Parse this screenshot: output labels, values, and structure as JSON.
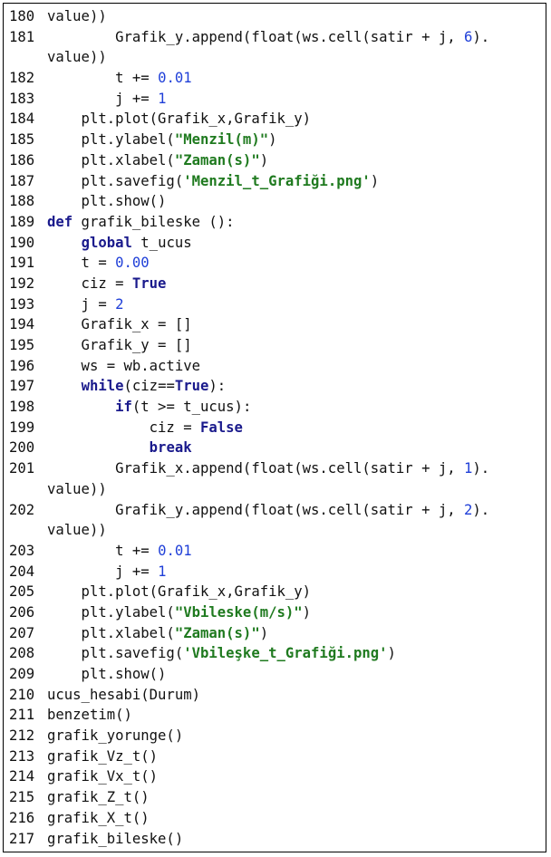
{
  "lines": [
    {
      "n": "180",
      "parts": [
        [
          "t",
          "value))"
        ]
      ]
    },
    {
      "n": "181",
      "parts": [
        [
          "t",
          "        Grafik_y.append(float(ws.cell(satir + j, "
        ],
        [
          "n",
          "6"
        ],
        [
          "t",
          ")."
        ]
      ]
    },
    {
      "n": "",
      "parts": [
        [
          "t",
          "value))"
        ]
      ]
    },
    {
      "n": "182",
      "parts": [
        [
          "t",
          "        t += "
        ],
        [
          "n",
          "0.01"
        ]
      ]
    },
    {
      "n": "183",
      "parts": [
        [
          "t",
          "        j += "
        ],
        [
          "n",
          "1"
        ]
      ]
    },
    {
      "n": "184",
      "parts": [
        [
          "t",
          "    plt.plot(Grafik_x,Grafik_y)"
        ]
      ]
    },
    {
      "n": "185",
      "parts": [
        [
          "t",
          "    plt.ylabel("
        ],
        [
          "s",
          "\"Menzil(m)\""
        ],
        [
          "t",
          ")"
        ]
      ]
    },
    {
      "n": "186",
      "parts": [
        [
          "t",
          "    plt.xlabel("
        ],
        [
          "s",
          "\"Zaman(s)\""
        ],
        [
          "t",
          ")"
        ]
      ]
    },
    {
      "n": "187",
      "parts": [
        [
          "t",
          "    plt.savefig("
        ],
        [
          "s",
          "'Menzil_t_Grafiği.png'"
        ],
        [
          "t",
          ")"
        ]
      ]
    },
    {
      "n": "188",
      "parts": [
        [
          "t",
          "    plt.show()"
        ]
      ]
    },
    {
      "n": "189",
      "parts": [
        [
          "k",
          "def"
        ],
        [
          "t",
          " grafik_bileske ():"
        ]
      ]
    },
    {
      "n": "190",
      "parts": [
        [
          "t",
          "    "
        ],
        [
          "k",
          "global"
        ],
        [
          "t",
          " t_ucus"
        ]
      ]
    },
    {
      "n": "191",
      "parts": [
        [
          "t",
          "    t = "
        ],
        [
          "n",
          "0.00"
        ]
      ]
    },
    {
      "n": "192",
      "parts": [
        [
          "t",
          "    ciz = "
        ],
        [
          "k",
          "True"
        ]
      ]
    },
    {
      "n": "193",
      "parts": [
        [
          "t",
          "    j = "
        ],
        [
          "n",
          "2"
        ]
      ]
    },
    {
      "n": "194",
      "parts": [
        [
          "t",
          "    Grafik_x = []"
        ]
      ]
    },
    {
      "n": "195",
      "parts": [
        [
          "t",
          "    Grafik_y = []"
        ]
      ]
    },
    {
      "n": "196",
      "parts": [
        [
          "t",
          "    ws = wb.active"
        ]
      ]
    },
    {
      "n": "197",
      "parts": [
        [
          "t",
          "    "
        ],
        [
          "k",
          "while"
        ],
        [
          "t",
          "(ciz=="
        ],
        [
          "k",
          "True"
        ],
        [
          "t",
          "):"
        ]
      ]
    },
    {
      "n": "198",
      "parts": [
        [
          "t",
          "        "
        ],
        [
          "k",
          "if"
        ],
        [
          "t",
          "(t >= t_ucus):"
        ]
      ]
    },
    {
      "n": "199",
      "parts": [
        [
          "t",
          "            ciz = "
        ],
        [
          "k",
          "False"
        ]
      ]
    },
    {
      "n": "200",
      "parts": [
        [
          "t",
          "            "
        ],
        [
          "k",
          "break"
        ]
      ]
    },
    {
      "n": "201",
      "parts": [
        [
          "t",
          "        Grafik_x.append(float(ws.cell(satir + j, "
        ],
        [
          "n",
          "1"
        ],
        [
          "t",
          ")."
        ]
      ]
    },
    {
      "n": "",
      "parts": [
        [
          "t",
          "value))"
        ]
      ]
    },
    {
      "n": "202",
      "parts": [
        [
          "t",
          "        Grafik_y.append(float(ws.cell(satir + j, "
        ],
        [
          "n",
          "2"
        ],
        [
          "t",
          ")."
        ]
      ]
    },
    {
      "n": "",
      "parts": [
        [
          "t",
          "value))"
        ]
      ]
    },
    {
      "n": "203",
      "parts": [
        [
          "t",
          "        t += "
        ],
        [
          "n",
          "0.01"
        ]
      ]
    },
    {
      "n": "204",
      "parts": [
        [
          "t",
          "        j += "
        ],
        [
          "n",
          "1"
        ]
      ]
    },
    {
      "n": "205",
      "parts": [
        [
          "t",
          "    plt.plot(Grafik_x,Grafik_y)"
        ]
      ]
    },
    {
      "n": "206",
      "parts": [
        [
          "t",
          "    plt.ylabel("
        ],
        [
          "s",
          "\"Vbileske(m/s)\""
        ],
        [
          "t",
          ")"
        ]
      ]
    },
    {
      "n": "207",
      "parts": [
        [
          "t",
          "    plt.xlabel("
        ],
        [
          "s",
          "\"Zaman(s)\""
        ],
        [
          "t",
          ")"
        ]
      ]
    },
    {
      "n": "208",
      "parts": [
        [
          "t",
          "    plt.savefig("
        ],
        [
          "s",
          "'Vbileşke_t_Grafiği.png'"
        ],
        [
          "t",
          ")"
        ]
      ]
    },
    {
      "n": "209",
      "parts": [
        [
          "t",
          "    plt.show()"
        ]
      ]
    },
    {
      "n": "210",
      "parts": [
        [
          "t",
          "ucus_hesabi(Durum)"
        ]
      ]
    },
    {
      "n": "211",
      "parts": [
        [
          "t",
          "benzetim()"
        ]
      ]
    },
    {
      "n": "212",
      "parts": [
        [
          "t",
          "grafik_yorunge()"
        ]
      ]
    },
    {
      "n": "213",
      "parts": [
        [
          "t",
          "grafik_Vz_t()"
        ]
      ]
    },
    {
      "n": "214",
      "parts": [
        [
          "t",
          "grafik_Vx_t()"
        ]
      ]
    },
    {
      "n": "215",
      "parts": [
        [
          "t",
          "grafik_Z_t()"
        ]
      ]
    },
    {
      "n": "216",
      "parts": [
        [
          "t",
          "grafik_X_t()"
        ]
      ]
    },
    {
      "n": "217",
      "parts": [
        [
          "t",
          "grafik_bileske()"
        ]
      ]
    }
  ]
}
